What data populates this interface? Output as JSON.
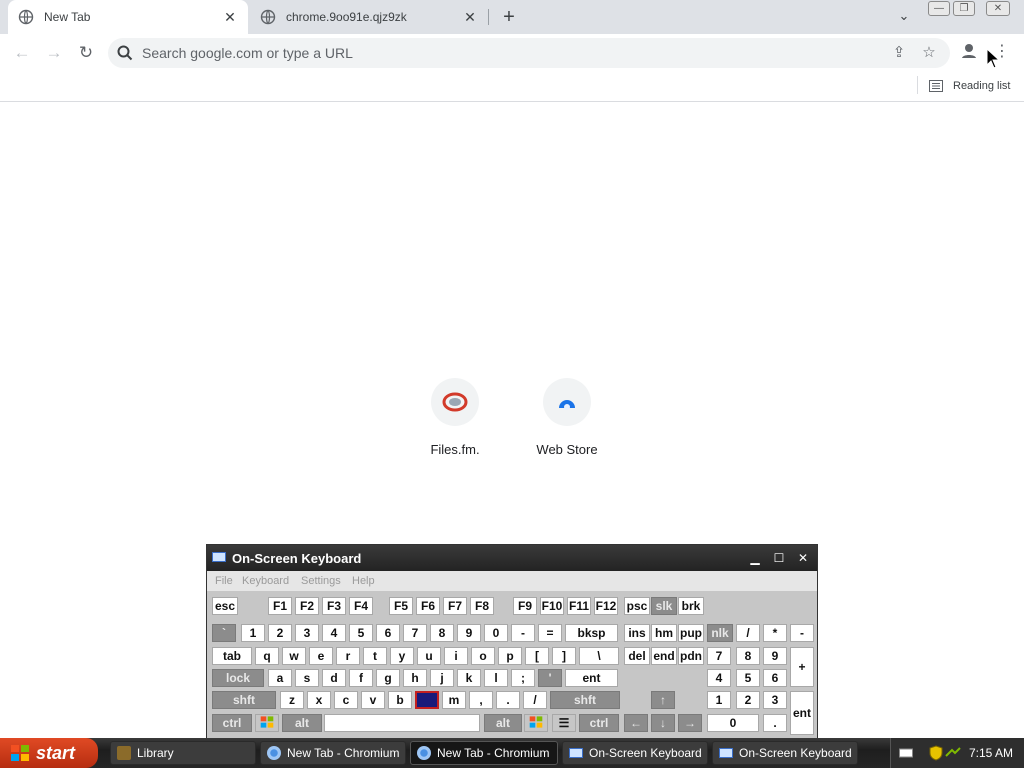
{
  "browser": {
    "tabs": [
      {
        "title": "New Tab",
        "active": true
      },
      {
        "title": "chrome.9oo91e.qjz9zk",
        "active": false
      }
    ],
    "omnibox": {
      "placeholder": "Search google.com or type a URL",
      "value": ""
    },
    "reading_list": "Reading list"
  },
  "shortcuts": [
    {
      "label": "Files.fm.",
      "icon": "files-fm-icon"
    },
    {
      "label": "Web Store",
      "icon": "web-store-icon"
    }
  ],
  "osk": {
    "title": "On-Screen Keyboard",
    "menu": [
      "File",
      "Keyboard",
      "Settings",
      "Help"
    ],
    "rows": {
      "fn": [
        "esc",
        "F1",
        "F2",
        "F3",
        "F4",
        "F5",
        "F6",
        "F7",
        "F8",
        "F9",
        "F10",
        "F11",
        "F12",
        "psc",
        "slk",
        "brk"
      ],
      "num": [
        "`",
        "1",
        "2",
        "3",
        "4",
        "5",
        "6",
        "7",
        "8",
        "9",
        "0",
        "-",
        "=",
        "bksp",
        "ins",
        "hm",
        "pup",
        "nlk",
        "/",
        "*",
        "-"
      ],
      "tab": [
        "tab",
        "q",
        "w",
        "e",
        "r",
        "t",
        "y",
        "u",
        "i",
        "o",
        "p",
        "[",
        "]",
        "\\",
        "del",
        "end",
        "pdn",
        "7",
        "8",
        "9",
        "+"
      ],
      "caps": [
        "lock",
        "a",
        "s",
        "d",
        "f",
        "g",
        "h",
        "j",
        "k",
        "l",
        ";",
        "'",
        "ent",
        "4",
        "5",
        "6"
      ],
      "shift": [
        "shft",
        "z",
        "x",
        "c",
        "v",
        "b",
        "n",
        "m",
        ",",
        ".",
        "/",
        "shft",
        "↑",
        "1",
        "2",
        "3",
        "ent"
      ],
      "ctrl": [
        "ctrl",
        "win",
        "alt",
        "",
        "alt",
        "win",
        "menu",
        "ctrl",
        "←",
        "↓",
        "→",
        "0",
        "."
      ]
    }
  },
  "taskbar": {
    "start": "start",
    "items": [
      "Library",
      "New Tab - Chromium",
      "New Tab - Chromium",
      "On-Screen Keyboard",
      "On-Screen Keyboard"
    ],
    "clock": "7:15 AM"
  }
}
